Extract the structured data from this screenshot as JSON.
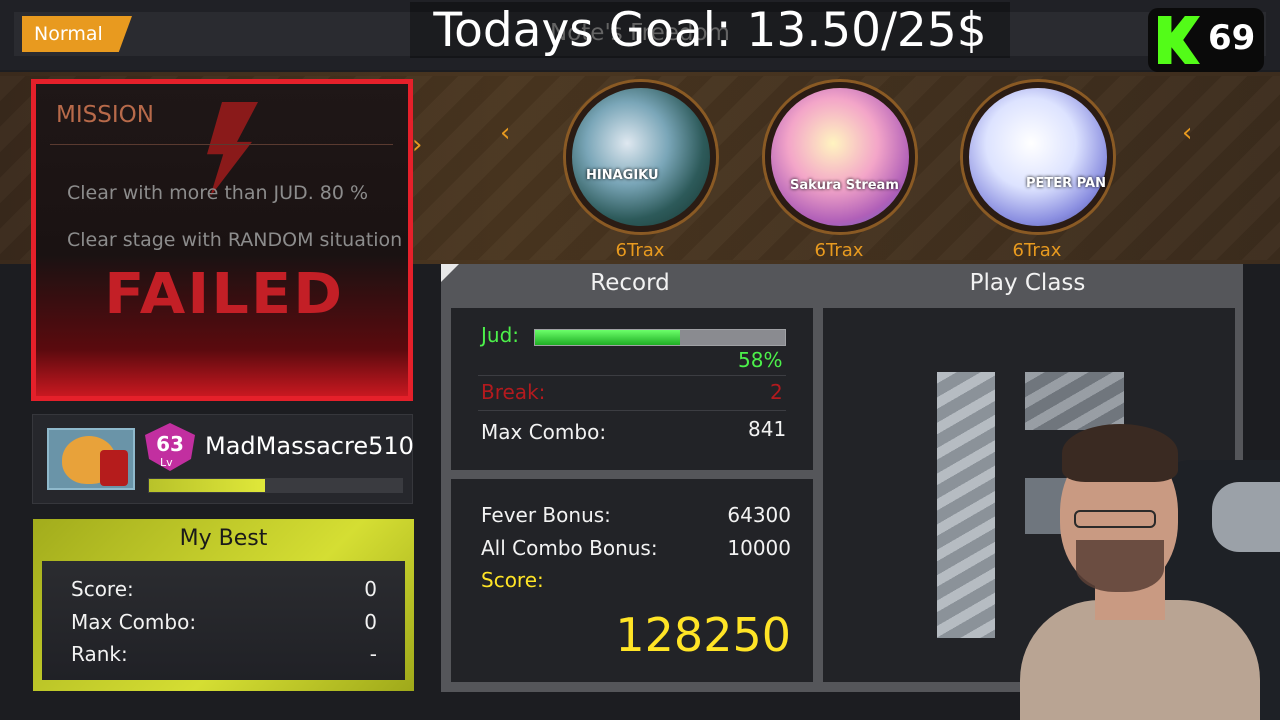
{
  "header": {
    "difficulty": "Normal",
    "song_title": "Note's Freedom",
    "goal_overlay": "Todays Goal: 13.50/25$",
    "viewer_count": "69"
  },
  "mission": {
    "title": "MISSION",
    "conditions": [
      "Clear with more than JUD.  80 %",
      "Clear stage with RANDOM situation"
    ],
    "result": "FAILED"
  },
  "trax": [
    {
      "label": "6Trax",
      "jacket_text": "HINAGIKU"
    },
    {
      "label": "6Trax",
      "jacket_text": "Sakura Stream"
    },
    {
      "label": "6Trax",
      "jacket_text": "PETER PAN"
    }
  ],
  "player": {
    "level": "63",
    "level_suffix": "Lv",
    "name": "MadMassacre510",
    "xp_fraction": 0.46
  },
  "my_best": {
    "title": "My Best",
    "rows": [
      {
        "label": "Score:",
        "value": "0"
      },
      {
        "label": "Max Combo:",
        "value": "0"
      },
      {
        "label": "Rank:",
        "value": "-"
      }
    ]
  },
  "record": {
    "header": "Record",
    "jud_label": "Jud:",
    "jud_percent_text": "58%",
    "jud_fraction": 0.58,
    "break_label": "Break:",
    "break_value": "2",
    "max_combo_label": "Max Combo:",
    "max_combo_value": "841",
    "fever_bonus_label": "Fever Bonus:",
    "fever_bonus_value": "64300",
    "all_combo_bonus_label": "All Combo Bonus:",
    "all_combo_bonus_value": "10000",
    "score_label": "Score:",
    "score_value": "128250"
  },
  "play_class": {
    "header": "Play Class"
  },
  "colors": {
    "accent_orange": "#e89a1f",
    "failed_red": "#c31f26",
    "jud_green": "#4cf04a",
    "score_yellow": "#ffe426",
    "best_panel_lime": "#d5de33",
    "kick_green": "#53fc18"
  }
}
